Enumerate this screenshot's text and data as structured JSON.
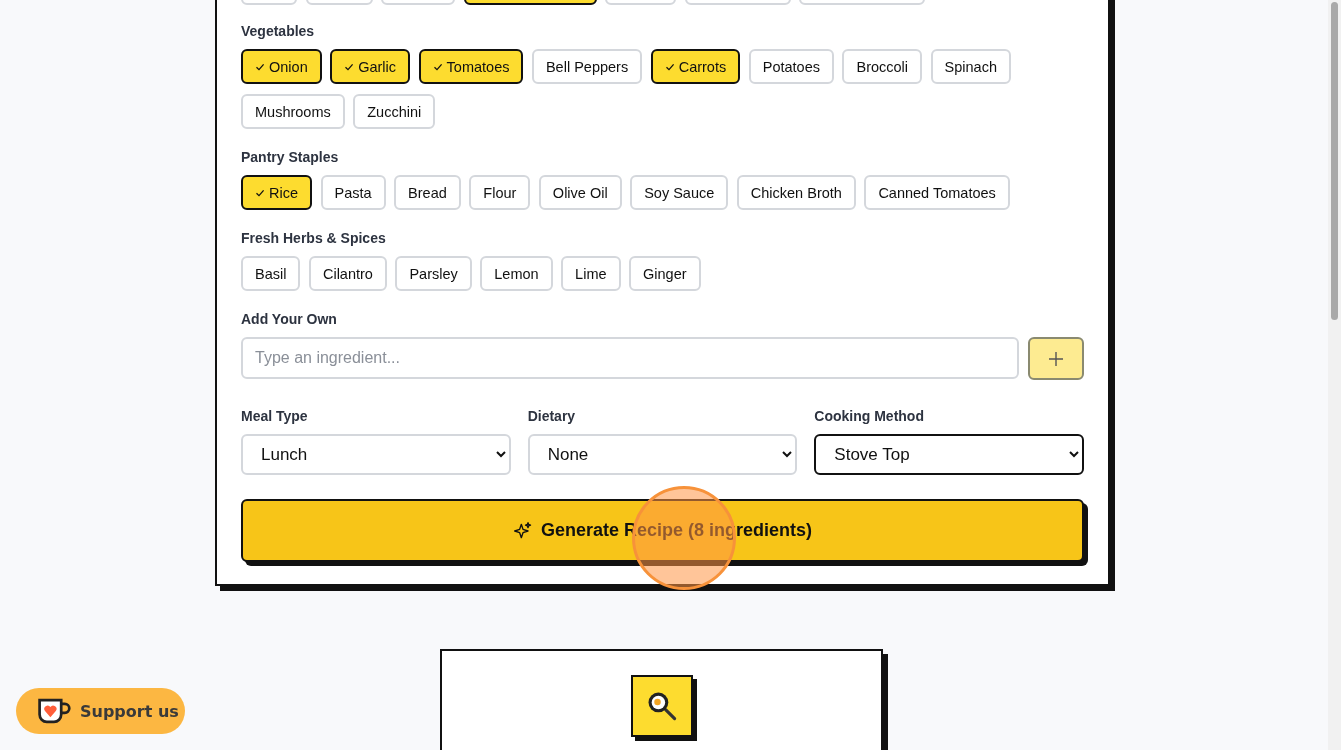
{
  "cut_off_chips": [
    {
      "selected": false
    },
    {
      "selected": false
    },
    {
      "selected": false
    },
    {
      "selected": true
    },
    {
      "selected": false
    },
    {
      "selected": false
    },
    {
      "selected": false
    }
  ],
  "groups": [
    {
      "label": "Vegetables",
      "items": [
        {
          "label": "Onion",
          "selected": true
        },
        {
          "label": "Garlic",
          "selected": true
        },
        {
          "label": "Tomatoes",
          "selected": true
        },
        {
          "label": "Bell Peppers",
          "selected": false
        },
        {
          "label": "Carrots",
          "selected": true
        },
        {
          "label": "Potatoes",
          "selected": false
        },
        {
          "label": "Broccoli",
          "selected": false
        },
        {
          "label": "Spinach",
          "selected": false
        },
        {
          "label": "Mushrooms",
          "selected": false
        },
        {
          "label": "Zucchini",
          "selected": false
        }
      ]
    },
    {
      "label": "Pantry Staples",
      "items": [
        {
          "label": "Rice",
          "selected": true
        },
        {
          "label": "Pasta",
          "selected": false
        },
        {
          "label": "Bread",
          "selected": false
        },
        {
          "label": "Flour",
          "selected": false
        },
        {
          "label": "Olive Oil",
          "selected": false
        },
        {
          "label": "Soy Sauce",
          "selected": false
        },
        {
          "label": "Chicken Broth",
          "selected": false
        },
        {
          "label": "Canned Tomatoes",
          "selected": false
        }
      ]
    },
    {
      "label": "Fresh Herbs & Spices",
      "items": [
        {
          "label": "Basil",
          "selected": false
        },
        {
          "label": "Cilantro",
          "selected": false
        },
        {
          "label": "Parsley",
          "selected": false
        },
        {
          "label": "Lemon",
          "selected": false
        },
        {
          "label": "Lime",
          "selected": false
        },
        {
          "label": "Ginger",
          "selected": false
        }
      ]
    }
  ],
  "add_own": {
    "label": "Add Your Own",
    "placeholder": "Type an ingredient...",
    "add_disabled": true
  },
  "selects": [
    {
      "label": "Meal Type",
      "value": "Lunch",
      "focused": false
    },
    {
      "label": "Dietary",
      "value": "None",
      "focused": false
    },
    {
      "label": "Cooking Method",
      "value": "Stove Top",
      "focused": true
    }
  ],
  "generate_button": "Generate Recipe (8 ingredients)",
  "support_button": "Support us"
}
